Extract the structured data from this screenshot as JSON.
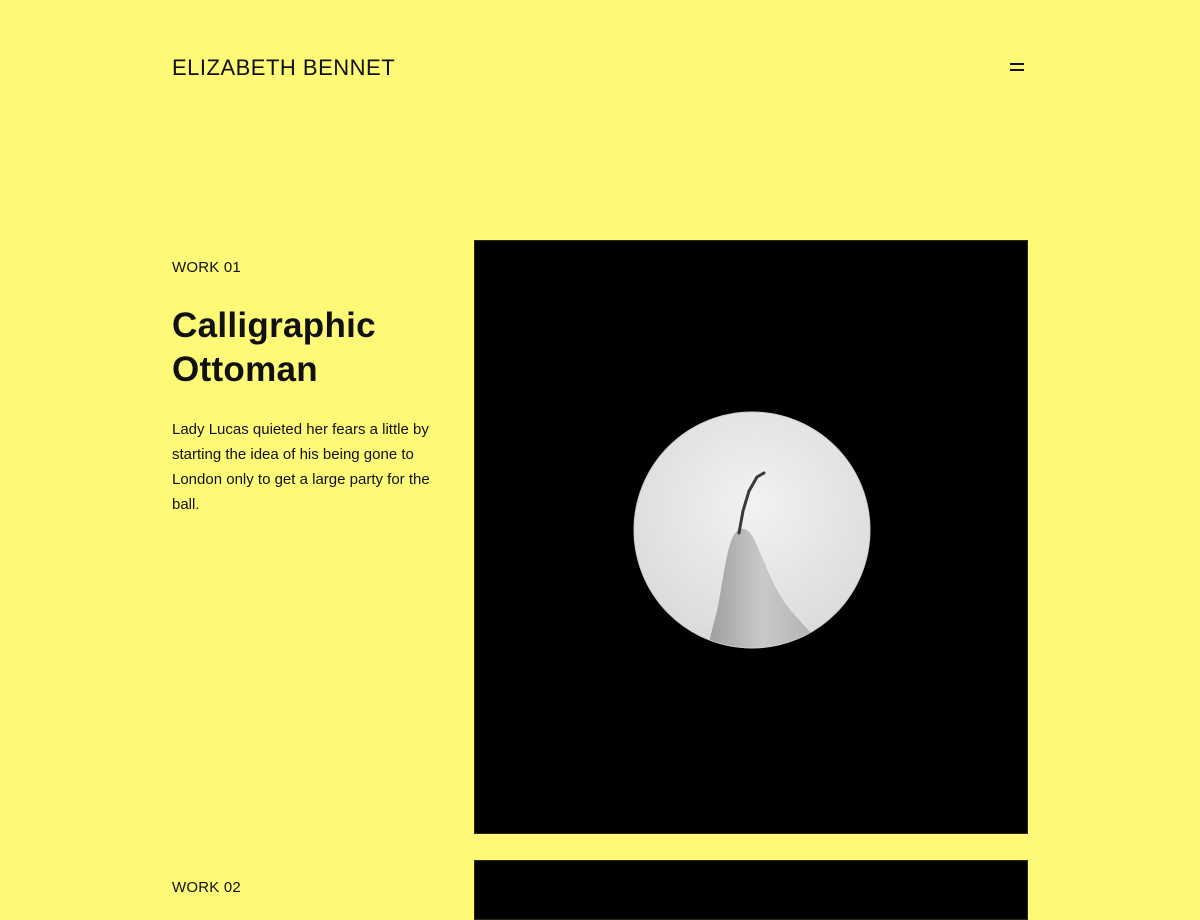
{
  "header": {
    "site_title": "ELIZABETH BENNET",
    "menu_icon": "hamburger-menu-icon"
  },
  "works": [
    {
      "label": "WORK 01",
      "title": "Calligraphic Ottoman",
      "description": "Lady Lucas quieted her fears a little by starting the idea of his being gone to London only to get a large party for the ball.",
      "image_subject": "pear-photo"
    },
    {
      "label": "WORK 02"
    }
  ],
  "colors": {
    "background": "#fff978",
    "text": "#111111",
    "image_background": "#000000"
  }
}
